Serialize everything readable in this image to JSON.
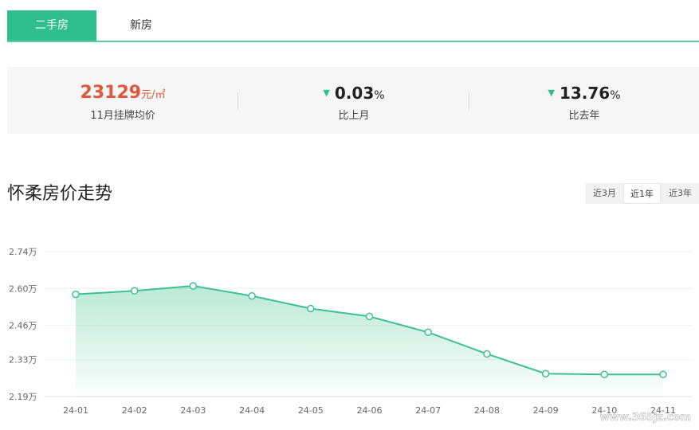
{
  "tabs": [
    {
      "label": "二手房",
      "active": true
    },
    {
      "label": "新房",
      "active": false
    }
  ],
  "stats": {
    "price": {
      "value": "23129",
      "unit": "元/㎡",
      "label": "11月挂牌均价"
    },
    "mom": {
      "direction": "down",
      "value": "0.03",
      "unit": "%",
      "label": "比上月"
    },
    "yoy": {
      "direction": "down",
      "value": "13.76",
      "unit": "%",
      "label": "比去年"
    }
  },
  "chart_header": {
    "title": "怀柔房价走势",
    "ranges": [
      "近3月",
      "近1年",
      "近3年"
    ],
    "selected_range": "近1年"
  },
  "watermark": "www.365jz.com",
  "colors": {
    "accent": "#2fbf8f",
    "price": "#e0573b",
    "line": "#3cc28f"
  },
  "chart_data": {
    "type": "area",
    "categories": [
      "24-01",
      "24-02",
      "24-03",
      "24-04",
      "24-05",
      "24-06",
      "24-07",
      "24-08",
      "24-09",
      "24-10",
      "24-11"
    ],
    "values": [
      2.578,
      2.591,
      2.61,
      2.572,
      2.524,
      2.494,
      2.434,
      2.352,
      2.277,
      2.274,
      2.274
    ],
    "y_tick_labels": [
      "2.74万",
      "2.60万",
      "2.46万",
      "2.33万",
      "2.19万"
    ],
    "y_ticks": [
      2.74,
      2.6,
      2.46,
      2.33,
      2.19
    ],
    "ylim": [
      2.19,
      2.74
    ],
    "title": "",
    "xlabel": "",
    "ylabel": "",
    "grid": true,
    "markers": true
  }
}
